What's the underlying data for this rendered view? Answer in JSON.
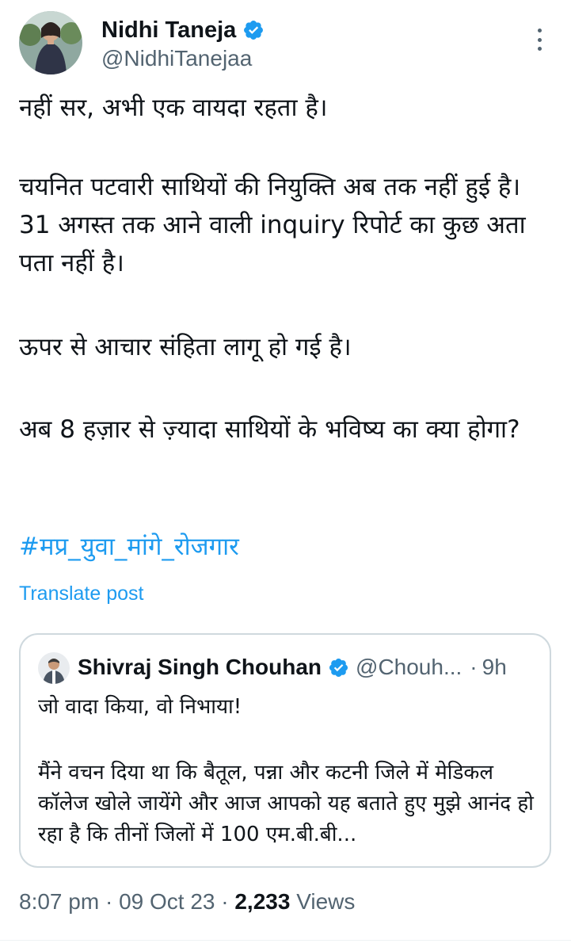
{
  "post": {
    "author": {
      "name": "Nidhi Taneja",
      "handle": "@NidhiTanejaa",
      "verified": true,
      "avatar_icon": "profile-photo"
    },
    "paragraphs": [
      "नहीं सर, अभी एक वायदा रहता है।",
      "चयनित पटवारी साथियों की नियुक्ति अब तक नहीं हुई है। 31 अगस्त तक आने वाली inquiry रिपोर्ट का कुछ अता पता नहीं है।",
      "ऊपर से आचार संहिता लागू हो गई है।",
      "अब 8 हज़ार से ज़्यादा साथियों के भविष्य का क्या होगा?"
    ],
    "hashtag": "#मप्र_युवा_मांगे_रोजगार",
    "translate_label": "Translate post",
    "quoted": {
      "author_name": "Shivraj Singh Chouhan",
      "handle": "@Chouh...",
      "separator": "·",
      "time": "9h",
      "verified": true,
      "line1": "जो वादा किया, वो निभाया!",
      "text": "मैंने वचन दिया था कि बैतूल, पन्ना और कटनी जिले में मेडिकल कॉलेज खोले जायेंगे और आज आपको यह बताते हुए मुझे आनंद हो रहा है कि तीनों जिलों में 100 एम.बी.बी..."
    },
    "meta": {
      "time": "8:07 pm",
      "dot": "·",
      "date": "09 Oct 23",
      "views_count": "2,233",
      "views_label": "Views"
    }
  },
  "colors": {
    "accent": "#1d9bf0",
    "secondary_text": "#536471",
    "primary_text": "#0f1419",
    "border": "#cfd9de"
  }
}
